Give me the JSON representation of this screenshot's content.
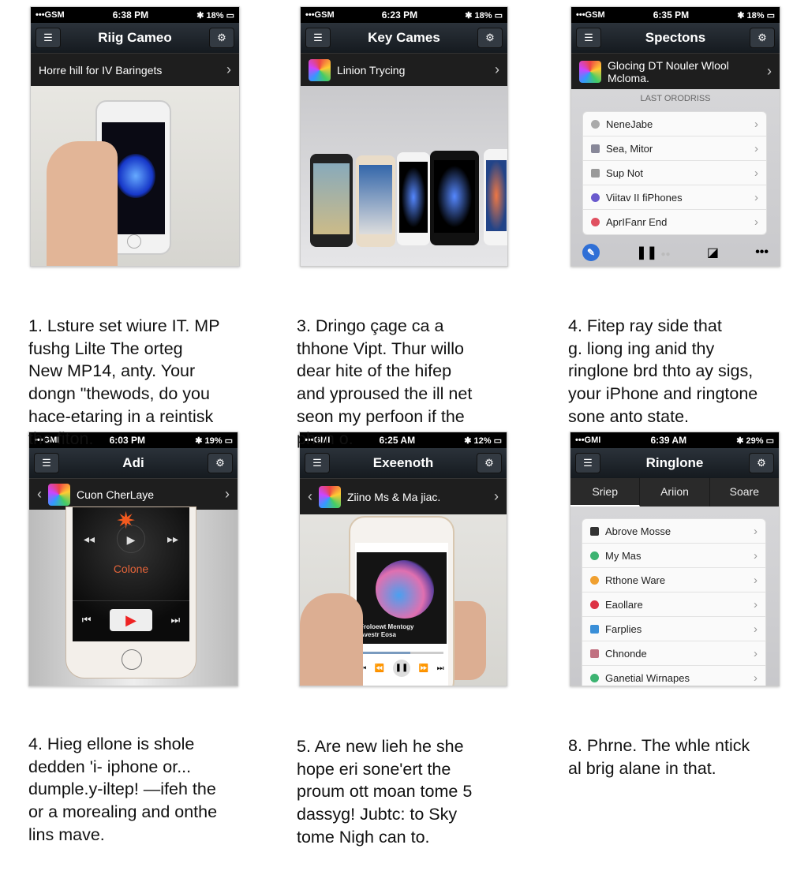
{
  "panels": [
    {
      "status": {
        "carrier": "•••GSM",
        "time": "6:38 PM",
        "battery": "18%"
      },
      "title": "Riig Cameo",
      "subheader": "Horre hill for IV Baringets"
    },
    {
      "status": {
        "carrier": "•••GSM",
        "time": "6:23 PM",
        "battery": "18%"
      },
      "title": "Key Cames",
      "subheader": "Linion Trycing"
    },
    {
      "status": {
        "carrier": "•••GSM",
        "time": "6:35 PM",
        "battery": "18%"
      },
      "title": "Spectons",
      "subheader": "Glocing DT Nouler Wlool Mcloma.",
      "section_label": "LAST ORODRISS",
      "items": [
        {
          "label": "NeneJabe",
          "color": "#aaaaaa"
        },
        {
          "label": "Sea, Mitor",
          "color": "#8888aa"
        },
        {
          "label": "Sup Not",
          "color": "#999999"
        },
        {
          "label": "Viitav II fiPhones",
          "color": "#6a5acd"
        },
        {
          "label": "AprIFanr End",
          "color": "#e05060"
        }
      ]
    },
    {
      "status": {
        "carrier": "•••GMI",
        "time": "6:03 PM",
        "battery": "19%"
      },
      "title": "Adi",
      "subheader": "Cuon CherLaye",
      "screen_label": "Colone"
    },
    {
      "status": {
        "carrier": "•••GMI",
        "time": "6:25 AM",
        "battery": "12%"
      },
      "title": "Exeenoth",
      "subheader": "Ziino Ms & Ma jiac.",
      "album_text": "Froloewt Mentogy Avestr Eosa"
    },
    {
      "status": {
        "carrier": "•••GMI",
        "time": "6:39 AM",
        "battery": "29%"
      },
      "title": "Ringlone",
      "tabs": [
        "Sriep",
        "Ariion",
        "Soare"
      ],
      "items": [
        {
          "label": "Abrove Mosse",
          "color": "#333333"
        },
        {
          "label": "My Mas",
          "color": "#3cb371"
        },
        {
          "label": "Rthone Ware",
          "color": "#f0a030"
        },
        {
          "label": "Eaollare",
          "color": "#dd3344"
        },
        {
          "label": "Farplies",
          "color": "#3a8fd8"
        },
        {
          "label": "Chnonde",
          "color": "#c07080"
        },
        {
          "label": "Ganetial Wirnapes",
          "color": "#3cb371"
        }
      ]
    }
  ],
  "captions": [
    [
      "1. Lsture set wiure IT. MP",
      "fushg Lilte The orteg",
      "New MP14, anty. Your",
      "dongn \"thewods, do you",
      "hace-etaring in a reintisk",
      "the fiton."
    ],
    [
      "3. Dringo çage ca a",
      "thhone Vipt.  Thur willo",
      "dear hite of the hifep",
      "and yproused the ill net",
      "seon my perfoon if the",
      "phon o."
    ],
    [
      "4. Fitep ray side that",
      "g. liong ing anid thy",
      "ringlone brd thto ay sigs,",
      "your iPhone and ringtone",
      "sone anto state."
    ],
    [
      "4. Hieg ellone is shole",
      "dedden 'i- iphone  or...",
      "dumple.y-iltep! —ifeh the",
      "or a morealing and onthe",
      "lins mave."
    ],
    [
      "5. Are new lieh he she",
      "hope eri sone'ert the",
      "proum ott moan tome 5",
      "dassyg! Jubtc: to Sky",
      "tome Nigh can to."
    ],
    [
      "8. Phrne. The whle ntick",
      "al brig alane in that."
    ]
  ]
}
